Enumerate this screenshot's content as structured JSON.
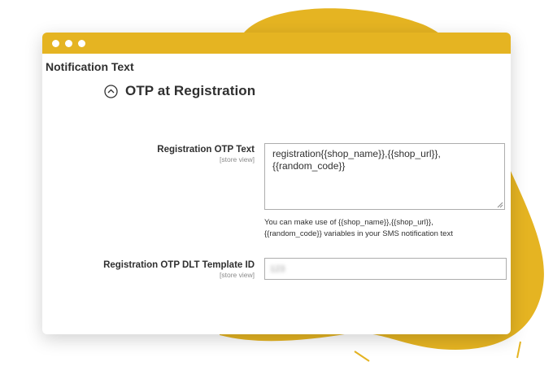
{
  "window": {
    "accent_color": "#e5b422",
    "controls": [
      "dot",
      "dot",
      "dot"
    ]
  },
  "section": {
    "title": "Notification Text"
  },
  "group": {
    "title": "OTP at Registration",
    "collapse_icon": "chevron-up-circle-icon"
  },
  "fields": {
    "otp_text": {
      "label": "Registration OTP Text",
      "scope": "[store view]",
      "value_line1": "registration{{shop_name}},{{shop_url}},",
      "value_line2": "{{random_code}}",
      "note_line1": "You can make use of {{shop_name}},{{shop_url}},",
      "note_line2": "{{random_code}} variables in your SMS notification text"
    },
    "dlt_template": {
      "label": "Registration OTP DLT Template ID",
      "scope": "[store view]",
      "value": "123"
    }
  }
}
